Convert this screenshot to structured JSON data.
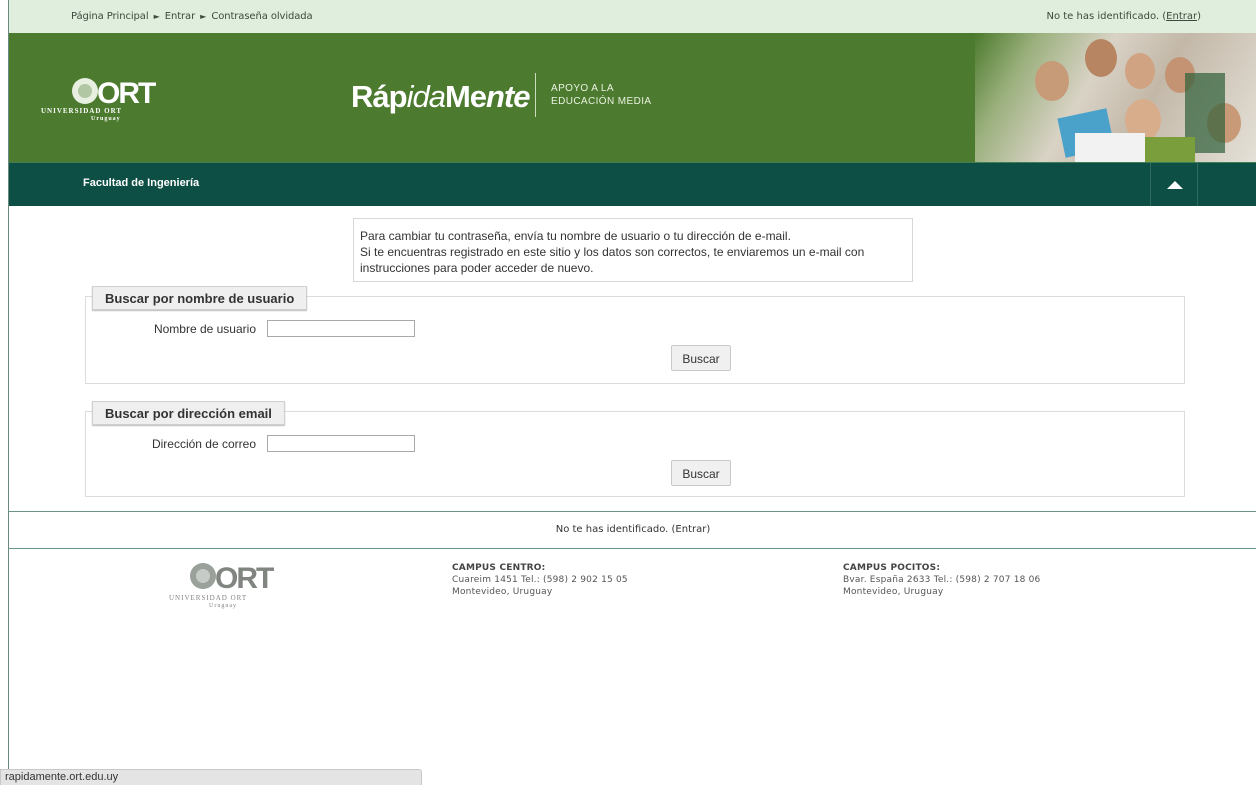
{
  "breadcrumb": {
    "home": "Página Principal",
    "sep": "►",
    "login": "Entrar",
    "current": "Contraseña olvidada"
  },
  "login_status": {
    "text": "No te has identificado. (",
    "link": "Entrar",
    "close": ")"
  },
  "header": {
    "logo_alt": "UNIVERSIDAD ORT Uruguay",
    "logo_word": "ORT",
    "logo_line1": "UNIVERSIDAD ORT",
    "logo_line2": "Uruguay",
    "brand_a": "Ráp",
    "brand_b": "ida",
    "brand_c": "Me",
    "brand_d": "nte",
    "tagline_1": "APOYO A LA",
    "tagline_2": "EDUCACIÓN MEDIA"
  },
  "section_bar": {
    "title": "Facultad de Ingeniería"
  },
  "info": {
    "line1": "Para cambiar tu contraseña, envía tu nombre de usuario o tu dirección de e-mail.",
    "line2": "Si te encuentras registrado en este sitio y los datos son correctos, te enviaremos un e-mail con instrucciones para poder acceder de nuevo."
  },
  "search_username": {
    "legend": "Buscar por nombre de usuario",
    "label": "Nombre de usuario",
    "value": "",
    "button": "Buscar"
  },
  "search_email": {
    "legend": "Buscar por dirección email",
    "label": "Dirección de correo",
    "value": "",
    "button": "Buscar"
  },
  "footer": {
    "login_text": "No te has identificado. (Entrar)",
    "campus_centro": {
      "title": "CAMPUS CENTRO:",
      "address": "Cuareim 1451 Tel.: (598) 2 902 15 05",
      "city": "Montevideo, Uruguay"
    },
    "campus_pocitos": {
      "title": "CAMPUS POCITOS:",
      "address": "Bvar. España 2633 Tel.: (598) 2 707 18 06",
      "city": "Montevideo, Uruguay"
    }
  },
  "status_bar": {
    "url": "rapidamente.ort.edu.uy"
  },
  "colors": {
    "topbar": "#dfeedd",
    "header_green": "#4c7a2e",
    "section_bar": "#0e4f45"
  }
}
